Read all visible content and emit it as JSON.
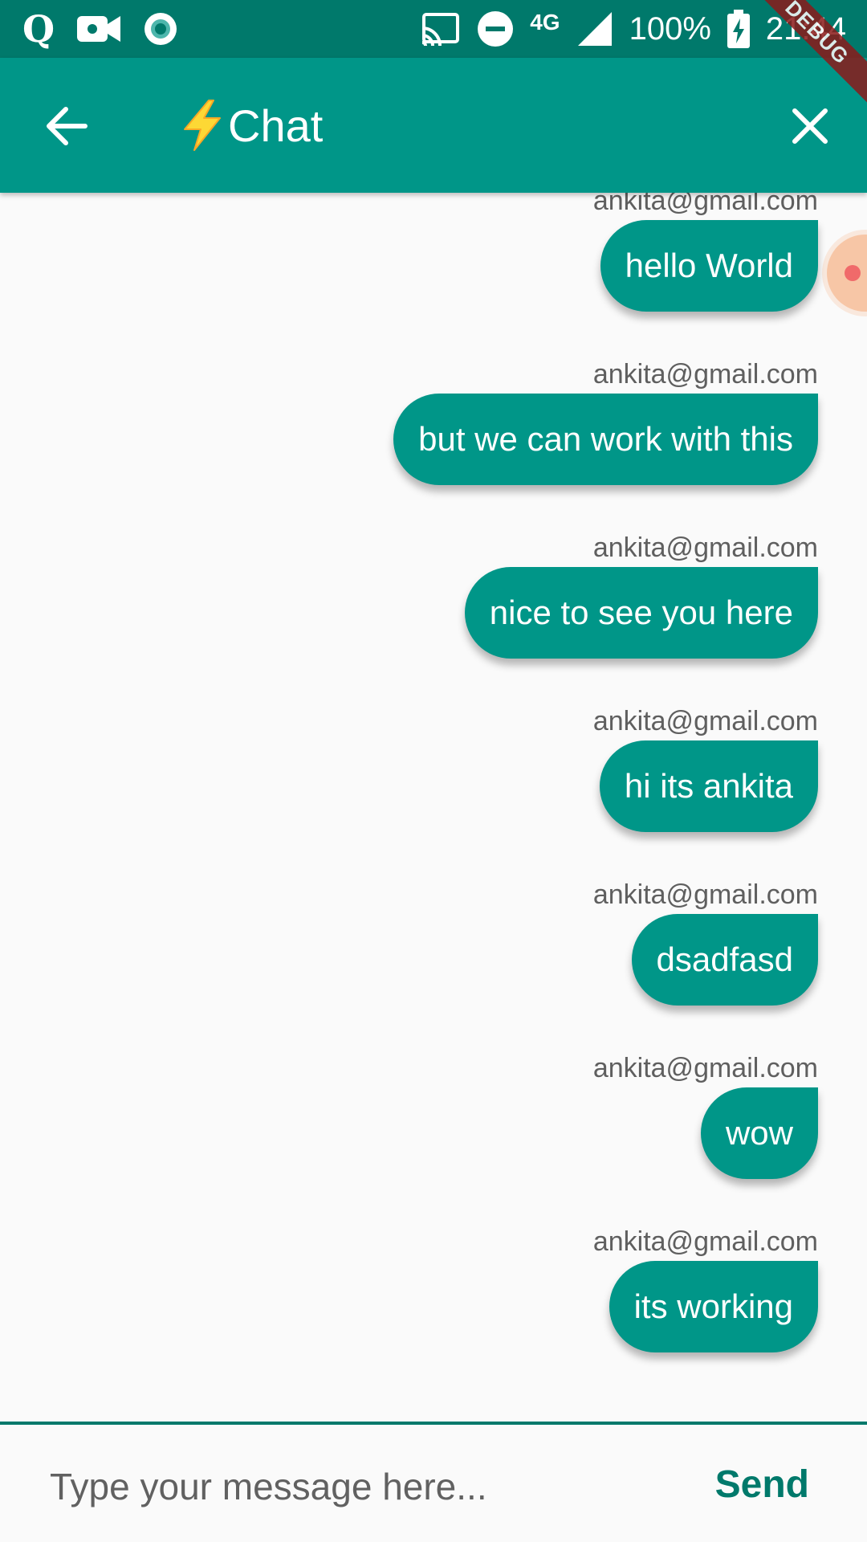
{
  "status_bar": {
    "battery": "100%",
    "network": "4G",
    "time": "21:44",
    "debug_banner": "DEBUG",
    "icons": [
      "q-app-icon",
      "video-camera-icon",
      "record-icon",
      "cast-icon",
      "do-not-disturb-icon",
      "signal-icon",
      "battery-charging-icon"
    ]
  },
  "app_bar": {
    "title": "Chat",
    "back_icon": "arrow-back-icon",
    "close_icon": "close-icon",
    "title_icon": "lightning-bolt-icon",
    "background_color": "#009688"
  },
  "messages": [
    {
      "sender": "ankita@gmail.com",
      "text": "hello World"
    },
    {
      "sender": "ankita@gmail.com",
      "text": "but we can work with this"
    },
    {
      "sender": "ankita@gmail.com",
      "text": "nice to see you here"
    },
    {
      "sender": "ankita@gmail.com",
      "text": "hi its ankita"
    },
    {
      "sender": "ankita@gmail.com",
      "text": "dsadfasd"
    },
    {
      "sender": "ankita@gmail.com",
      "text": "wow"
    },
    {
      "sender": "ankita@gmail.com",
      "text": "its working"
    }
  ],
  "composer": {
    "placeholder": "Type your message here...",
    "value": "",
    "send_label": "Send",
    "accent_color": "#00796b"
  }
}
